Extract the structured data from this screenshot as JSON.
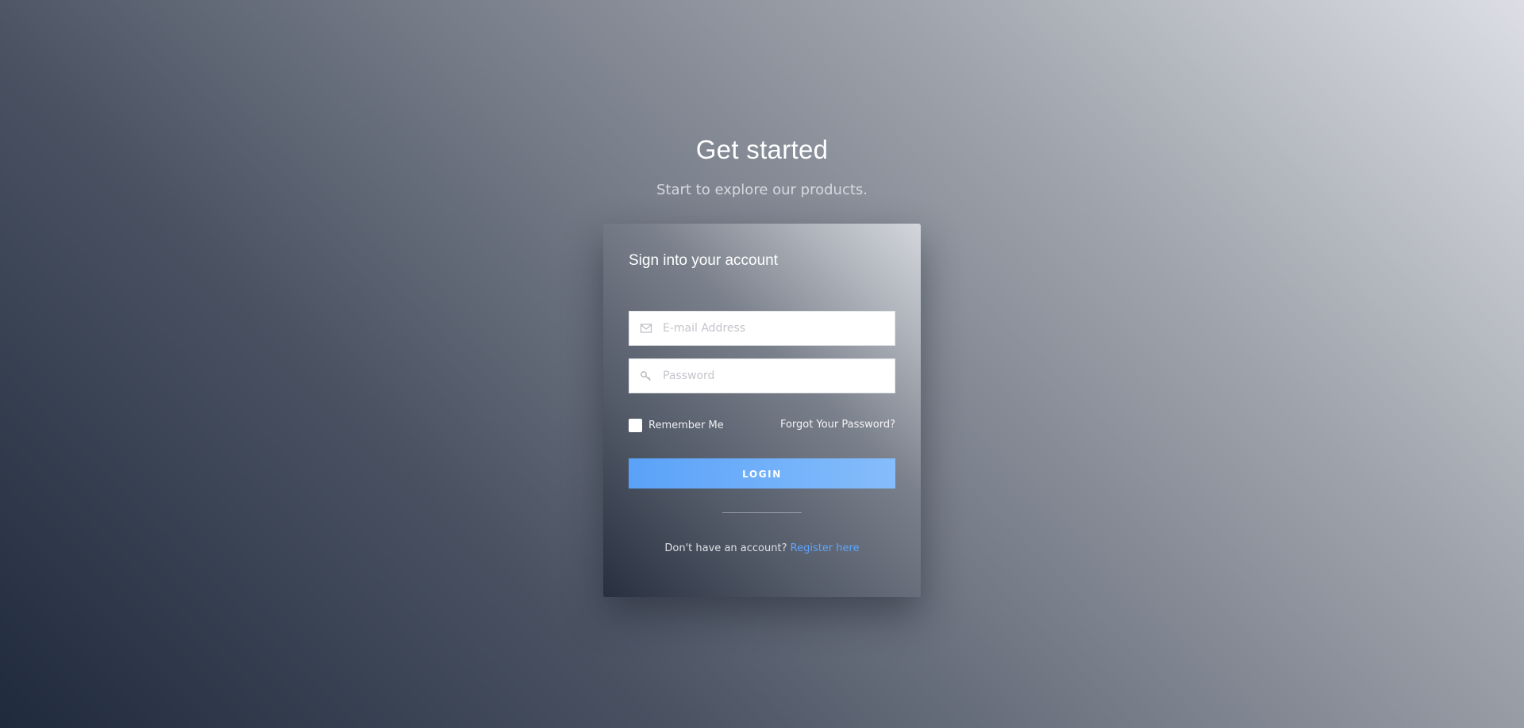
{
  "header": {
    "title": "Get started",
    "subtitle": "Start to explore our products."
  },
  "card": {
    "title": "Sign into your account",
    "email": {
      "placeholder": "E-mail Address",
      "value": "",
      "icon": "envelope-icon"
    },
    "password": {
      "placeholder": "Password",
      "value": "",
      "icon": "key-icon"
    },
    "remember_me": {
      "label": "Remember Me",
      "checked": false
    },
    "forgot_password_label": "Forgot Your Password?",
    "login_label": "LOGIN",
    "register": {
      "prompt": "Don't have an account?",
      "link_label": "Register here"
    }
  },
  "colors": {
    "accent": "#5aa2f8",
    "link": "#5ea5ff"
  }
}
